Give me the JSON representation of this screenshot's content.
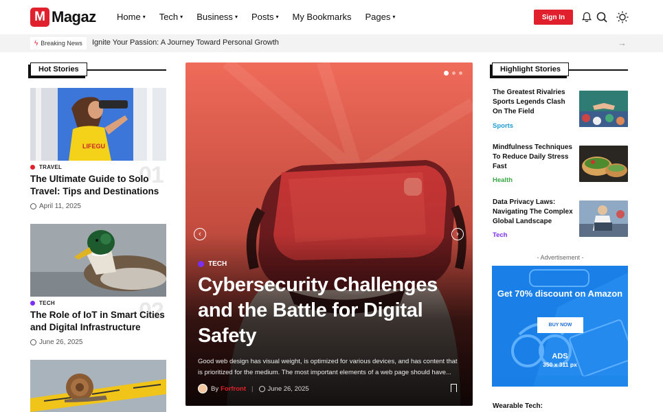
{
  "brand": {
    "mark": "M",
    "name": "Magaz",
    "accent": "#e0202c"
  },
  "nav": {
    "items": [
      {
        "label": "Home",
        "has_caret": true
      },
      {
        "label": "Tech",
        "has_caret": true
      },
      {
        "label": "Business",
        "has_caret": true
      },
      {
        "label": "Posts",
        "has_caret": true
      },
      {
        "label": "My Bookmarks",
        "has_caret": false
      },
      {
        "label": "Pages",
        "has_caret": true
      }
    ],
    "caret": "▾",
    "signin_label": "Sign In",
    "icons": [
      "bell-icon",
      "search-icon",
      "sun-icon"
    ]
  },
  "breaking": {
    "label": "Breaking News",
    "headline": "Ignite Your Passion: A Journey Toward Personal Growth",
    "next_icon": "arrow-right-icon"
  },
  "hot_stories": {
    "heading": "Hot Stories",
    "items": [
      {
        "category": "TRAVEL",
        "cat_color": "#e0202c",
        "number": "01",
        "title": "The Ultimate Guide to Solo Travel: Tips and Destinations",
        "date": "April 11, 2025"
      },
      {
        "category": "TECH",
        "cat_color": "#7b2ff2",
        "number": "02",
        "title": "The Role of IoT in Smart Cities and Digital Infrastructure",
        "date": "June 26, 2025"
      }
    ]
  },
  "hero": {
    "category": "TECH",
    "cat_color": "#7b2ff2",
    "title": "Cybersecurity Challenges and the Battle for Digital Safety",
    "description": "Good web design has visual weight, is optimized for various devices, and has content that is prioritized for the medium. The most important elements of a web page should have...",
    "by": "By",
    "author": "Forfront",
    "date": "June 26, 2025",
    "slides": {
      "count": 3,
      "active": 1
    },
    "prev_icon": "chevron-left-icon",
    "next_icon": "chevron-right-icon"
  },
  "highlight_stories": {
    "heading": "Highlight Stories",
    "items": [
      {
        "title": "The Greatest Rivalries Sports Legends Clash On The Field",
        "category": "Sports",
        "cat_color": "#1e9bd7"
      },
      {
        "title": "Mindfulness Techniques To Reduce Daily Stress Fast",
        "category": "Health",
        "cat_color": "#3aa845"
      },
      {
        "title": "Data Privacy Laws: Navigating The Complex Global Landscape",
        "category": "Tech",
        "cat_color": "#7b2ff2"
      }
    ]
  },
  "ad": {
    "label": "- Advertisement -",
    "headline": "Get 70% discount on Amazon",
    "button": "BUY NOW",
    "sub": "ADS",
    "size": "350 x 311 px"
  },
  "next_highlight": {
    "title": "Wearable Tech:"
  }
}
